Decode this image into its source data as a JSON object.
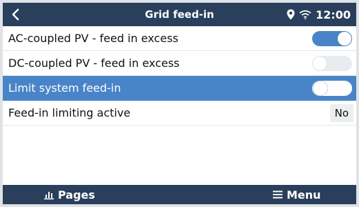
{
  "titlebar": {
    "title": "Grid feed-in",
    "time": "12:00",
    "icons": [
      "back-arrow-icon",
      "location-pin-icon",
      "wifi-icon"
    ]
  },
  "settings": [
    {
      "label": "AC-coupled PV - feed in excess",
      "control": "toggle",
      "state": "on"
    },
    {
      "label": "DC-coupled PV - feed in excess",
      "control": "toggle",
      "state": "off"
    },
    {
      "label": "Limit system feed-in",
      "control": "toggle",
      "state": "off",
      "selected": true
    },
    {
      "label": "Feed-in limiting active",
      "control": "value",
      "value": "No"
    }
  ],
  "bottombar": {
    "pages_label": "Pages",
    "menu_label": "Menu"
  },
  "colors": {
    "bar": "#2a3f5c",
    "accent": "#4a84c8",
    "toggle_off": "#e9ecef"
  }
}
